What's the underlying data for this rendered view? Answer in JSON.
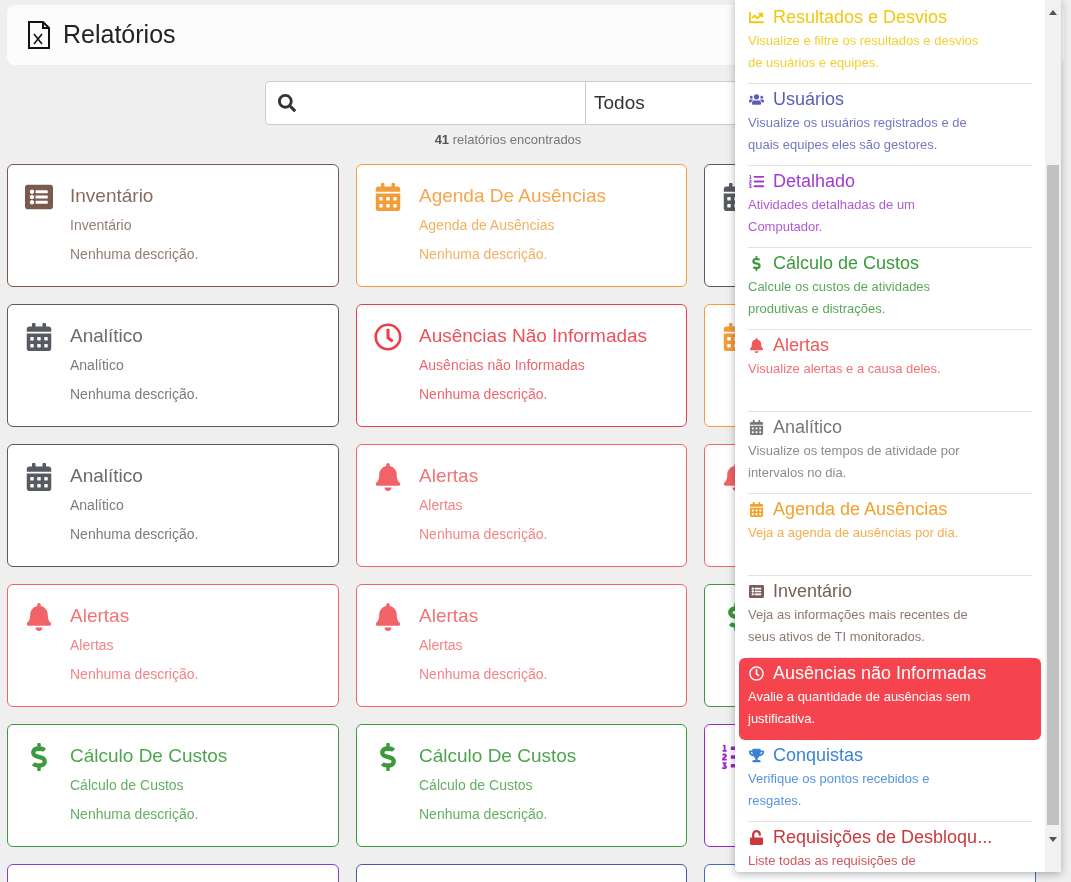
{
  "header": {
    "title": "Relatórios"
  },
  "search": {
    "filter_value": "Todos",
    "count": "41",
    "count_label": "relatórios encontrados"
  },
  "cards": [
    {
      "kind": "inventory",
      "color": "#7b5a4e",
      "title": "Inventário",
      "subtitle": "Inventário",
      "description": "Nenhuma descrição."
    },
    {
      "kind": "schedule",
      "color": "#f39c3a",
      "title": "Agenda De Ausências",
      "subtitle": "Agenda de Ausências",
      "description": "Nenhuma descrição."
    },
    {
      "kind": "calendar",
      "color": "#555b60"
    },
    {
      "kind": "calendar",
      "color": "#555b60",
      "title": "Analítico",
      "subtitle": "Analítico",
      "description": "Nenhuma descrição."
    },
    {
      "kind": "absence",
      "color": "#e8404a",
      "title": "Ausências Não Informadas",
      "subtitle": "Ausências não Informadas",
      "description": "Nenhuma descrição."
    },
    {
      "kind": "schedule",
      "color": "#f39c3a"
    },
    {
      "kind": "calendar",
      "color": "#555b60",
      "title": "Analítico",
      "subtitle": "Analítico",
      "description": "Nenhuma descrição."
    },
    {
      "kind": "alert",
      "color": "#f06468",
      "title": "Alertas",
      "subtitle": "Alertas",
      "description": "Nenhuma descrição."
    },
    {
      "kind": "alert",
      "color": "#f06468"
    },
    {
      "kind": "alert",
      "color": "#f06468",
      "title": "Alertas",
      "subtitle": "Alertas",
      "description": "Nenhuma descrição."
    },
    {
      "kind": "alert",
      "color": "#f06468",
      "title": "Alertas",
      "subtitle": "Alertas",
      "description": "Nenhuma descrição."
    },
    {
      "kind": "cost",
      "color": "#3c9a3c"
    },
    {
      "kind": "cost",
      "color": "#3c9a3c",
      "title": "Cálculo De Custos",
      "subtitle": "Cálculo de Custos",
      "description": "Nenhuma descrição."
    },
    {
      "kind": "cost",
      "color": "#3c9a3c",
      "title": "Cálculo De Custos",
      "subtitle": "Cálculo de Custos",
      "description": "Nenhuma descrição."
    },
    {
      "kind": "detail",
      "color": "#9b27c9"
    },
    {
      "kind": "blank",
      "color": "#8e3cc8"
    },
    {
      "kind": "blank",
      "color": "#4a56a8"
    },
    {
      "kind": "blank",
      "color": "#3a6fc0"
    }
  ],
  "menu": {
    "items": [
      {
        "kind": "results",
        "color": "#f2c80f",
        "title": "Resultados e Desvios",
        "description": "Visualize e filtre os resultados e desvios de usuários e equipes.",
        "selected": false
      },
      {
        "kind": "users",
        "color": "#5b5fb3",
        "title": "Usuários",
        "description": "Visualize os usuários registrados e de quais equipes eles são gestores.",
        "selected": false
      },
      {
        "kind": "detail",
        "color": "#a23cd0",
        "title": "Detalhado",
        "description": "Atividades detalhadas de um Computador.",
        "selected": false
      },
      {
        "kind": "cost",
        "color": "#3c9a3c",
        "title": "Cálculo de Custos",
        "description": "Calcule os custos de atividades produtivas e distrações.",
        "selected": false
      },
      {
        "kind": "alert",
        "color": "#f0585c",
        "title": "Alertas",
        "description": "Visualize alertas e a causa deles.",
        "selected": false
      },
      {
        "kind": "calendar",
        "color": "#777777",
        "title": "Analítico",
        "description": "Visualize os tempos de atividade por intervalos no dia.",
        "selected": false
      },
      {
        "kind": "schedule",
        "color": "#f3a12e",
        "title": "Agenda de Ausências",
        "description": "Veja a agenda de ausências por dia.",
        "selected": false
      },
      {
        "kind": "inventory",
        "color": "#7b5e56",
        "title": "Inventário",
        "description": "Veja as informações mais recentes de seus ativos de TI monitorados.",
        "selected": false
      },
      {
        "kind": "absence",
        "color": "#f5444e",
        "title": "Ausências não Informadas",
        "description": "Avalie a quantidade de ausências sem justificativa.",
        "selected": true
      },
      {
        "kind": "trophy",
        "color": "#3a82d6",
        "title": "Conquistas",
        "description": "Verifique os pontos recebidos e resgates.",
        "selected": false
      },
      {
        "kind": "unlock",
        "color": "#c8393d",
        "title": "Requisições de Desbloqu...",
        "description": "Liste todas as requisições de",
        "selected": false
      }
    ]
  }
}
